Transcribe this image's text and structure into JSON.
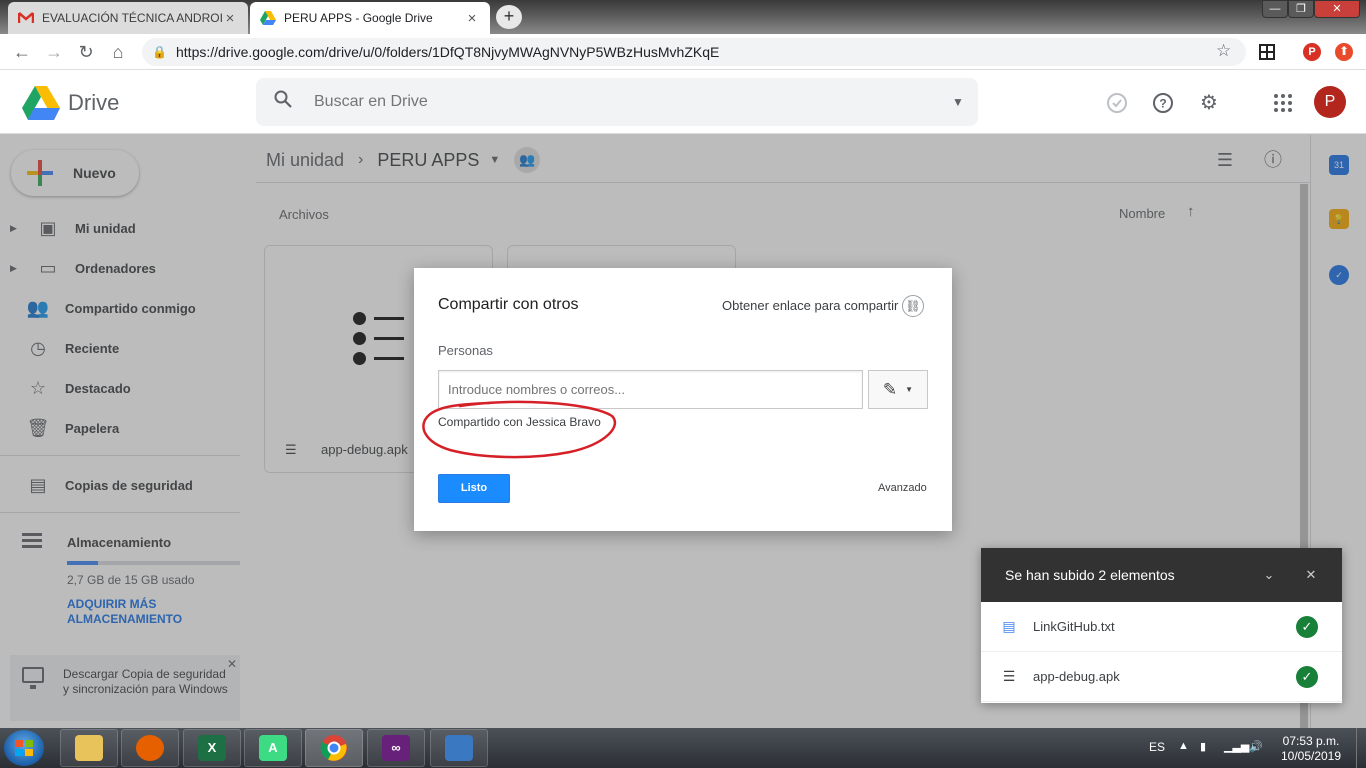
{
  "browser": {
    "tabs": [
      {
        "title": "EVALUACIÓN TÉCNICA ANDROID",
        "close": "×",
        "icon": "gmail-icon"
      },
      {
        "title": "PERU APPS - Google Drive",
        "close": "×",
        "icon": "drive-icon"
      }
    ],
    "new_tab": "+",
    "url": "https://drive.google.com/drive/u/0/folders/1DfQT8NjvyMWAgNVNyP5WBzHusMvhZKqE",
    "profile_initial": "P",
    "window_controls": {
      "minimize": "—",
      "maximize": "❐",
      "close": "✕"
    }
  },
  "header": {
    "brand": "Drive",
    "search_placeholder": "Buscar en Drive",
    "avatar_initial": "P"
  },
  "sidebar": {
    "new_button": "Nuevo",
    "items": [
      {
        "label": "Mi unidad",
        "icon": "my-drive-icon"
      },
      {
        "label": "Ordenadores",
        "icon": "computers-icon"
      },
      {
        "label": "Compartido conmigo",
        "icon": "shared-with-me-icon"
      },
      {
        "label": "Reciente",
        "icon": "clock-icon"
      },
      {
        "label": "Destacado",
        "icon": "star-icon"
      },
      {
        "label": "Papelera",
        "icon": "trash-icon"
      },
      {
        "label": "Copias de seguridad",
        "icon": "backup-icon"
      }
    ],
    "storage": {
      "title": "Almacenamiento",
      "used_text": "2,7 GB de 15 GB usado",
      "used_fraction": 0.18,
      "upgrade_link": "ADQUIRIR MÁS ALMACENAMIENTO"
    },
    "backup_banner": "Descargar Copia de seguridad y sincronización para Windows"
  },
  "main": {
    "breadcrumb": {
      "root": "Mi unidad",
      "separator": "›",
      "current": "PERU APPS"
    },
    "section_label": "Archivos",
    "sort_label": "Nombre",
    "files": [
      {
        "name": "app-debug.apk"
      }
    ]
  },
  "dialog": {
    "title": "Compartir con otros",
    "get_link": "Obtener enlace para compartir",
    "people_label": "Personas",
    "input_placeholder": "Introduce nombres o correos...",
    "shared_with": "Compartido con Jessica Bravo",
    "done_button": "Listo",
    "advanced_link": "Avanzado",
    "annotation_color": "#d62027"
  },
  "upload_toast": {
    "title": "Se han subido 2 elementos",
    "items": [
      {
        "name": "LinkGitHub.txt",
        "icon": "doc-icon"
      },
      {
        "name": "app-debug.apk",
        "icon": "list-file-icon"
      }
    ]
  },
  "taskbar": {
    "language": "ES",
    "time": "07:53 p.m.",
    "date": "10/05/2019"
  },
  "colors": {
    "accent_blue": "#1a73e8",
    "done_button": "#1a8cff",
    "success_green": "#188038",
    "toast_header": "#323232"
  }
}
